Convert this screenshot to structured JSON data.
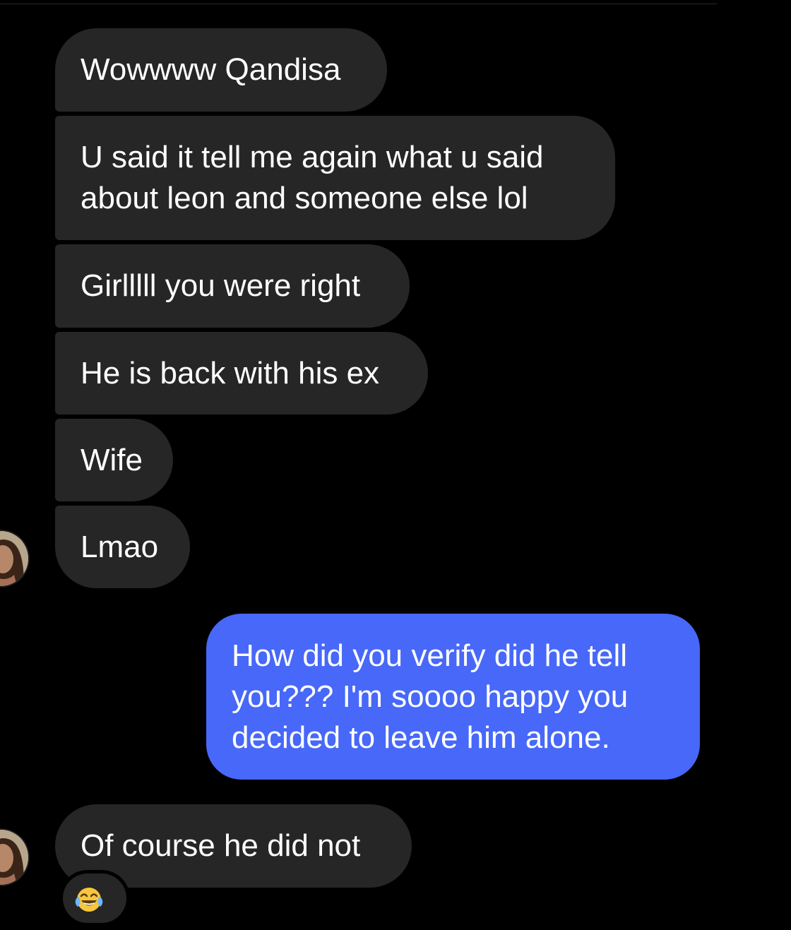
{
  "conversation": {
    "incoming_group_1": [
      "Wowwww Qandisa",
      "U said it tell me again what u said\nabout leon and someone else lol",
      "Girlllll you were right",
      "He is back with his ex",
      "Wife",
      "Lmao"
    ],
    "outgoing": "How did you verify did he tell\nyou??? I'm soooo happy you\ndecided to leave him alone.",
    "incoming_group_2": "Of course he did not",
    "reaction_emoji": "😂"
  },
  "colors": {
    "background": "#000000",
    "incoming_bubble": "#262626",
    "outgoing_bubble": "#4768f8",
    "text": "#ffffff"
  },
  "icons": {
    "avatar": "contact-avatar",
    "reaction": "tears-of-joy-emoji"
  }
}
